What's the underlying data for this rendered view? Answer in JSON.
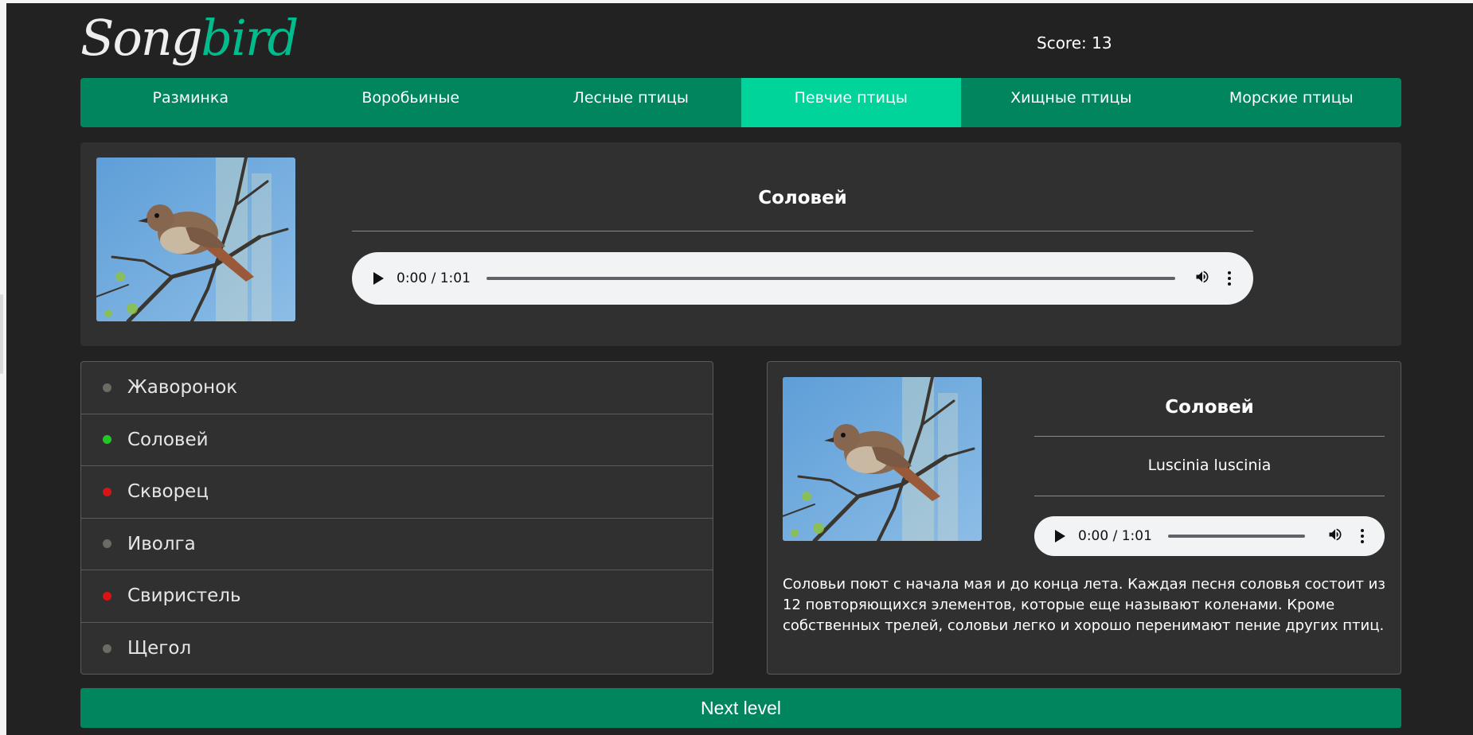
{
  "logo": {
    "part1": "Song",
    "part2": "bird"
  },
  "score": {
    "label": "Score: 13"
  },
  "nav": {
    "items": [
      {
        "label": "Разминка"
      },
      {
        "label": "Воробьиные"
      },
      {
        "label": "Лесные птицы"
      },
      {
        "label": "Певчие птицы",
        "active": true
      },
      {
        "label": "Хищные птицы"
      },
      {
        "label": "Морские птицы"
      }
    ]
  },
  "question": {
    "title": "Соловей",
    "audio": {
      "time": "0:00 / 1:01"
    }
  },
  "answers": [
    {
      "label": "Жаворонок",
      "status": "neutral"
    },
    {
      "label": "Соловей",
      "status": "correct"
    },
    {
      "label": "Скворец",
      "status": "wrong"
    },
    {
      "label": "Иволга",
      "status": "neutral"
    },
    {
      "label": "Свиристель",
      "status": "wrong"
    },
    {
      "label": "Щегол",
      "status": "neutral"
    }
  ],
  "details": {
    "title": "Соловей",
    "latin": "Luscinia luscinia",
    "audio": {
      "time": "0:00 / 1:01"
    },
    "description": "Соловьи поют с начала мая и до конца лета. Каждая песня соловья состоит из 12 повторяющихся элементов, которые еще называют коленами. Кроме собственных трелей, соловьи легко и хорошо перенимают пение других птиц."
  },
  "next_button": {
    "label": "Next level"
  },
  "colors": {
    "accent": "#00855e",
    "accent_active": "#00d49a",
    "correct": "#1fc91f",
    "wrong": "#d81414",
    "neutral": "#6b6b65"
  }
}
